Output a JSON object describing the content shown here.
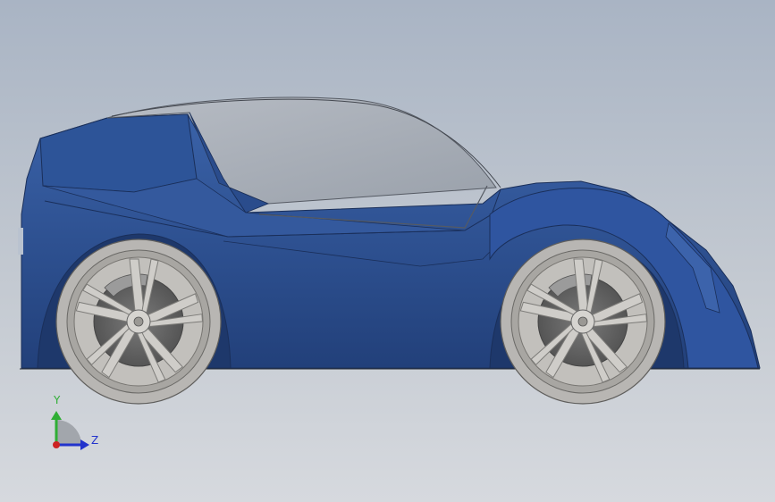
{
  "viewport": {
    "background_top": "#a9b4c4",
    "background_bottom": "#d6d9de"
  },
  "model": {
    "body_color": "#2c4f91",
    "body_shadow": "#22407a",
    "glass_color": "#a7adb6",
    "tire_color": "#b8b6b3",
    "rim_color": "#8a8986",
    "disc_color": "#6c6c6c",
    "caliper_color": "#9b9b9b"
  },
  "triad": {
    "y_label": "Y",
    "z_label": "Z",
    "y_color": "#2fae35",
    "z_color": "#2233cc",
    "origin_color": "#cc2222"
  }
}
